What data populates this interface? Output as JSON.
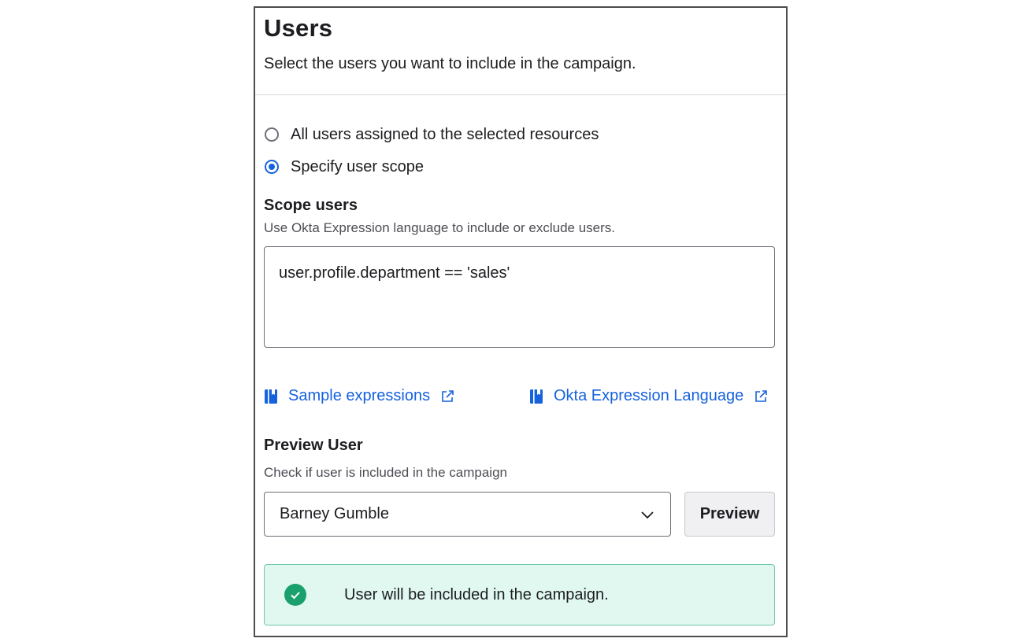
{
  "header": {
    "title": "Users",
    "subtitle": "Select the users you want to include in the campaign."
  },
  "scope_options": [
    {
      "label": "All users assigned to the selected resources",
      "selected": false
    },
    {
      "label": "Specify user scope",
      "selected": true
    }
  ],
  "scope_users": {
    "label": "Scope users",
    "hint": "Use Okta Expression language to include or exclude users.",
    "value": "user.profile.department == 'sales'"
  },
  "links": {
    "sample": "Sample expressions",
    "language": "Okta Expression Language"
  },
  "preview": {
    "label": "Preview User",
    "hint": "Check if user is included in the campaign",
    "selected_user": "Barney Gumble",
    "button_label": "Preview"
  },
  "result": {
    "message": "User will be included in the campaign.",
    "status": "success"
  },
  "colors": {
    "accent": "#1662dd",
    "success": "#1aa06d",
    "success_bg": "#e0f8ef"
  }
}
